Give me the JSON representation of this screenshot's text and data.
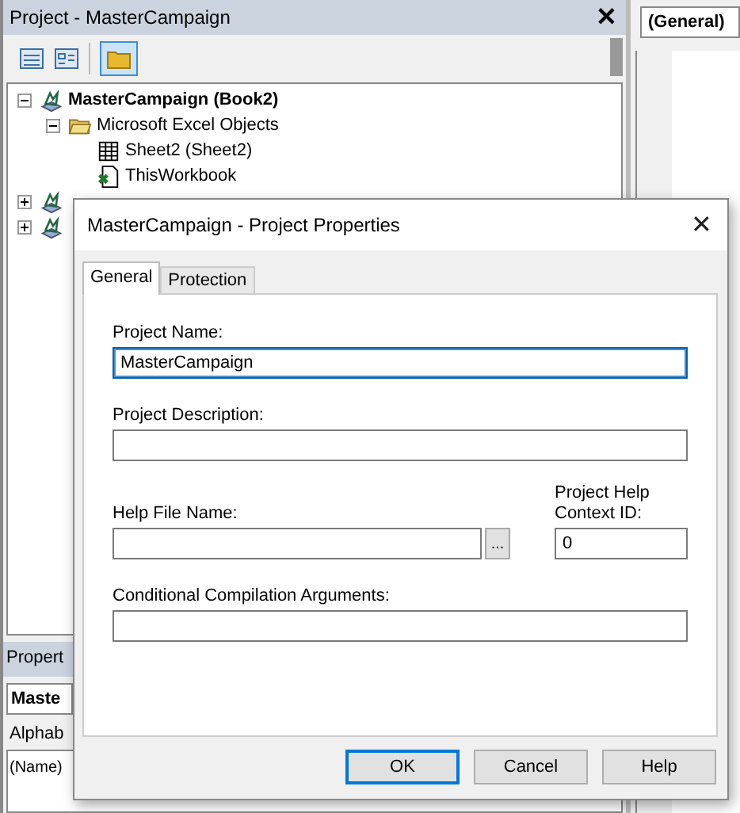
{
  "project_pane": {
    "title": "Project - MasterCampaign",
    "close": "✕",
    "tree": [
      {
        "label": "MasterCampaign (Book2)",
        "kind": "project",
        "expanded": true,
        "children": [
          {
            "label": "Microsoft Excel Objects",
            "kind": "folder",
            "expanded": true,
            "children": [
              {
                "label": "Sheet2 (Sheet2)",
                "kind": "sheet"
              },
              {
                "label": "ThisWorkbook",
                "kind": "workbook"
              }
            ]
          }
        ]
      },
      {
        "kind": "project",
        "expanded": false
      },
      {
        "kind": "project",
        "expanded": false
      }
    ]
  },
  "properties_pane": {
    "title": "Propert",
    "object": "Maste",
    "tab": "Alphab",
    "cell": "(Name)"
  },
  "code_pane": {
    "object_dropdown": "(General)"
  },
  "dialog": {
    "title": "MasterCampaign - Project Properties",
    "close": "✕",
    "tabs": [
      {
        "label": "General",
        "selected": true
      },
      {
        "label": "Protection",
        "selected": false
      }
    ],
    "fields": [
      {
        "label": "Project Name:",
        "value": "MasterCampaign",
        "focused": true
      },
      {
        "label": "Project Description:",
        "focused": false
      }
    ],
    "help_file": {
      "label": "Help File Name:",
      "browse": "..."
    },
    "context_id": {
      "label": "Project Help Context ID:",
      "value": "0"
    },
    "arguments": {
      "label": "Conditional Compilation Arguments:"
    },
    "buttons": [
      {
        "label": "OK",
        "default": true
      },
      {
        "label": "Cancel",
        "default": false
      },
      {
        "label": "Help",
        "default": false
      }
    ]
  }
}
